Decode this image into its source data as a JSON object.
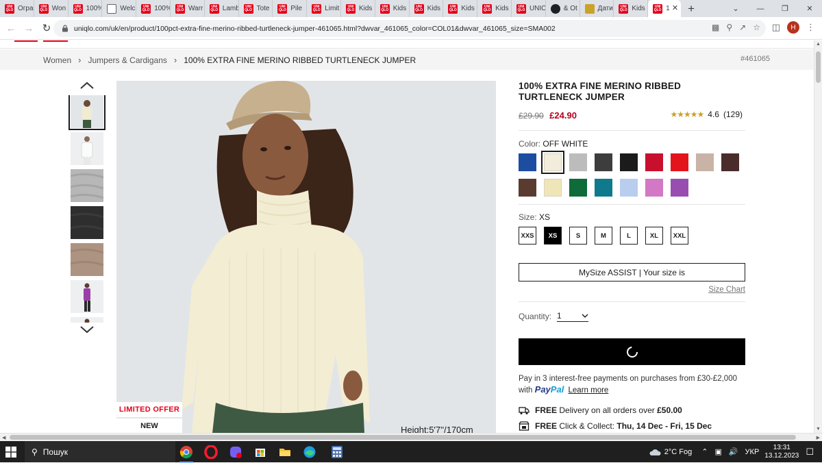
{
  "browser": {
    "tabs": [
      {
        "label": "Огра",
        "icon": "uniqlo-favicon"
      },
      {
        "label": "Won",
        "icon": "uniqlo-favicon"
      },
      {
        "label": "100%",
        "icon": "uniqlo-favicon"
      },
      {
        "label": "Welc",
        "icon": "web-favicon"
      },
      {
        "label": "100%",
        "icon": "uniqlo-favicon"
      },
      {
        "label": "Warr",
        "icon": "uniqlo-favicon"
      },
      {
        "label": "Lamb",
        "icon": "uniqlo-favicon"
      },
      {
        "label": "Tote",
        "icon": "uniqlo-favicon"
      },
      {
        "label": "Pile",
        "icon": "uniqlo-favicon"
      },
      {
        "label": "Limit",
        "icon": "uniqlo-favicon"
      },
      {
        "label": "Kids",
        "icon": "uniqlo-favicon"
      },
      {
        "label": "Kids",
        "icon": "uniqlo-favicon"
      },
      {
        "label": "Kids",
        "icon": "uniqlo-favicon"
      },
      {
        "label": "Kids",
        "icon": "uniqlo-favicon"
      },
      {
        "label": "Kids",
        "icon": "uniqlo-favicon"
      },
      {
        "label": "UNIC",
        "icon": "uniqlo-favicon"
      },
      {
        "label": "& Ot",
        "icon": "globe-favicon"
      },
      {
        "label": "Дати",
        "icon": "picture-favicon"
      },
      {
        "label": "Kids",
        "icon": "uniqlo-favicon"
      }
    ],
    "active_tab": {
      "label": "1",
      "icon": "uniqlo-favicon",
      "close": "✕"
    },
    "new_tab": "+",
    "url": "uniqlo.com/uk/en/product/100pct-extra-fine-merino-ribbed-turtleneck-jumper-461065.html?dwvar_461065_color=COL01&dwvar_461065_size=SMA002",
    "profile_initial": "H"
  },
  "breadcrumb": {
    "items": [
      "Women",
      "Jumpers & Cardigans",
      "100% EXTRA FINE MERINO RIBBED TURTLENECK JUMPER"
    ],
    "product_number": "#461065"
  },
  "gallery": {
    "badges": {
      "limited": "LIMITED OFFER",
      "new": "NEW"
    },
    "height_note": "Height:5'7''/170cm"
  },
  "product": {
    "title": "100% EXTRA FINE MERINO RIBBED TURTLENECK JUMPER",
    "old_price": "£29.90",
    "price": "£24.90",
    "rating_value": 4.6,
    "rating_text": "4.6",
    "review_count": "(129)",
    "color_label": "Color:",
    "color_value": "OFF WHITE",
    "colors": [
      "#1c4da1",
      "#f2ecdc",
      "#bcbcbc",
      "#3d3d3d",
      "#1b1b1b",
      "#c8102e",
      "#e3141b",
      "#c8b3a6",
      "#4a2c2a",
      "#5a3b30",
      "#efe6b8",
      "#0e6b3a",
      "#0f7a8c",
      "#b9cdef",
      "#d278c4",
      "#9a4db1"
    ],
    "selected_color_index": 1,
    "size_label": "Size:",
    "size_value": "XS",
    "sizes": [
      "XXS",
      "XS",
      "S",
      "M",
      "L",
      "XL",
      "XXL"
    ],
    "selected_size_index": 1,
    "mysize_label": "MySize ASSIST | Your size is",
    "size_chart": "Size Chart",
    "quantity_label": "Quantity:",
    "quantity_value": "1",
    "paypal_text": "Pay in 3 interest-free payments on purchases from £30-£2,000 with",
    "paypal_logo_1": "Pay",
    "paypal_logo_2": "Pal",
    "learn_more": "Learn more",
    "delivery_free": "FREE",
    "delivery_text": "Delivery on all orders over",
    "delivery_amount": "£50.00",
    "collect_free": "FREE",
    "collect_text": "Click & Collect:",
    "collect_dates": "Thu, 14 Dec - Fri, 15 Dec"
  },
  "taskbar": {
    "search_placeholder": "Пошук",
    "weather": "2°C  Fog",
    "language": "УКР",
    "time": "13:31",
    "date": "13.12.2023"
  },
  "colors": {
    "brand_red": "#e3001b",
    "sale_red": "#b4001c",
    "star_gold": "#c9a227"
  }
}
